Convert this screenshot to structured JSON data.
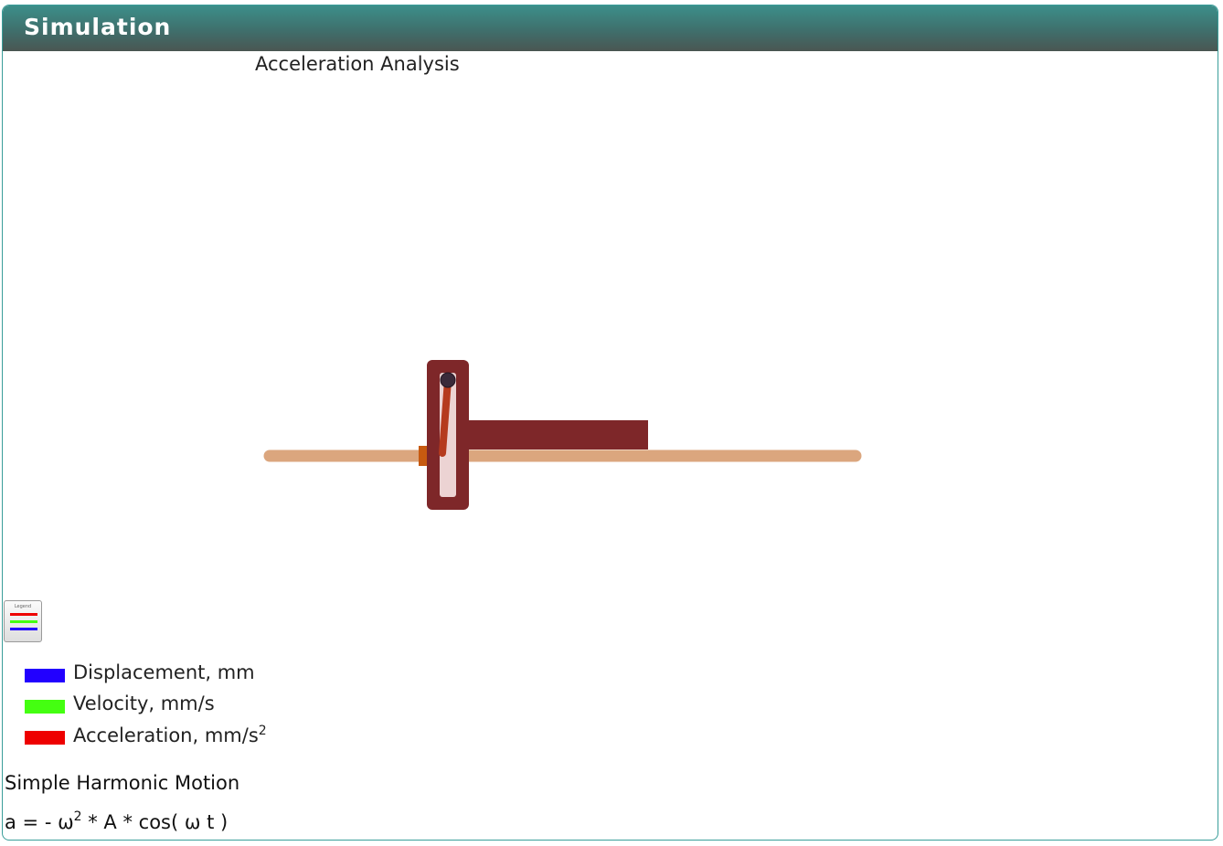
{
  "panel": {
    "title": "Simulation"
  },
  "simulation": {
    "title": "Acceleration Analysis"
  },
  "legend_toggle": {
    "icon": "legend-icon",
    "caption": "Legend"
  },
  "legend": {
    "items": [
      {
        "label": "Displacement, mm",
        "color": "#2200ff"
      },
      {
        "label": "Velocity, mm/s",
        "color": "#44ff11"
      },
      {
        "label": "Acceleration, mm/s",
        "superscript": "2",
        "color": "#ee0000"
      }
    ]
  },
  "motion": {
    "name": "Simple Harmonic Motion",
    "formula": {
      "lhs": "a = - ω",
      "exp": "2",
      "rhs": " * A * cos( ω t )"
    }
  },
  "colors": {
    "header_top": "#3c8f8a",
    "header_bottom": "#4a5652",
    "rail": "#dba67e",
    "yoke": "#7e2729",
    "slider_block": "#c75a10",
    "crank_pin": "#3a2a3a"
  }
}
